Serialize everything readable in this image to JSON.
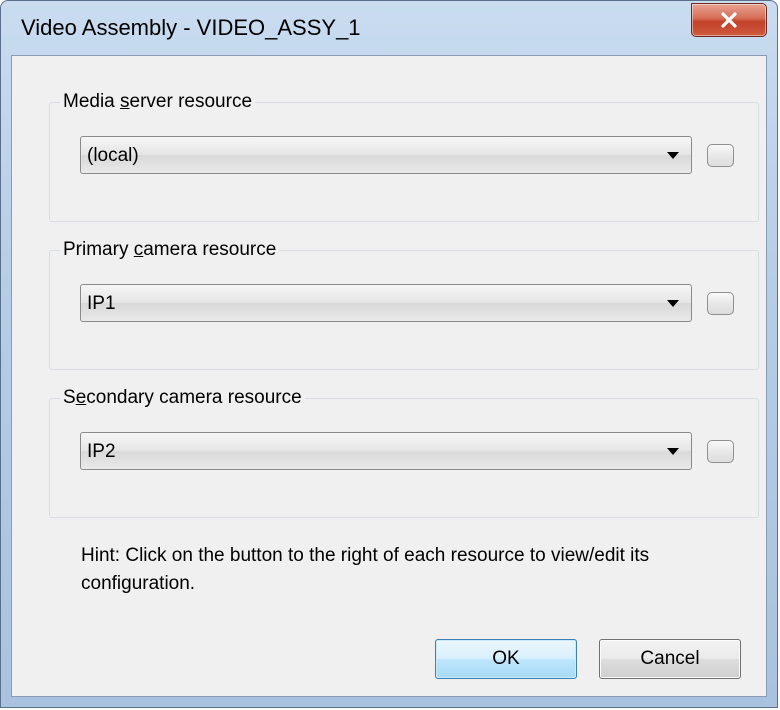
{
  "window": {
    "title": "Video Assembly - VIDEO_ASSY_1",
    "close_glyph": "✕"
  },
  "groups": [
    {
      "label_pre": "Media ",
      "label_key": "s",
      "label_post": "erver resource",
      "selected": "(local)"
    },
    {
      "label_pre": "Primary ",
      "label_key": "c",
      "label_post": "amera resource",
      "selected": "IP1"
    },
    {
      "label_pre": "S",
      "label_key": "e",
      "label_post": "condary camera resource",
      "selected": "IP2"
    }
  ],
  "hint": "Hint: Click on the button to the right of each resource to view/edit its configuration.",
  "buttons": {
    "ok": "OK",
    "cancel": "Cancel"
  },
  "colors": {
    "title_bar": "#b6cde6",
    "close_button": "#c2412a",
    "dialog_bg": "#f0f0f0",
    "ok_border": "#3c7fb1"
  },
  "icons": {
    "close": "close-icon",
    "dropdown": "chevron-down-icon"
  }
}
